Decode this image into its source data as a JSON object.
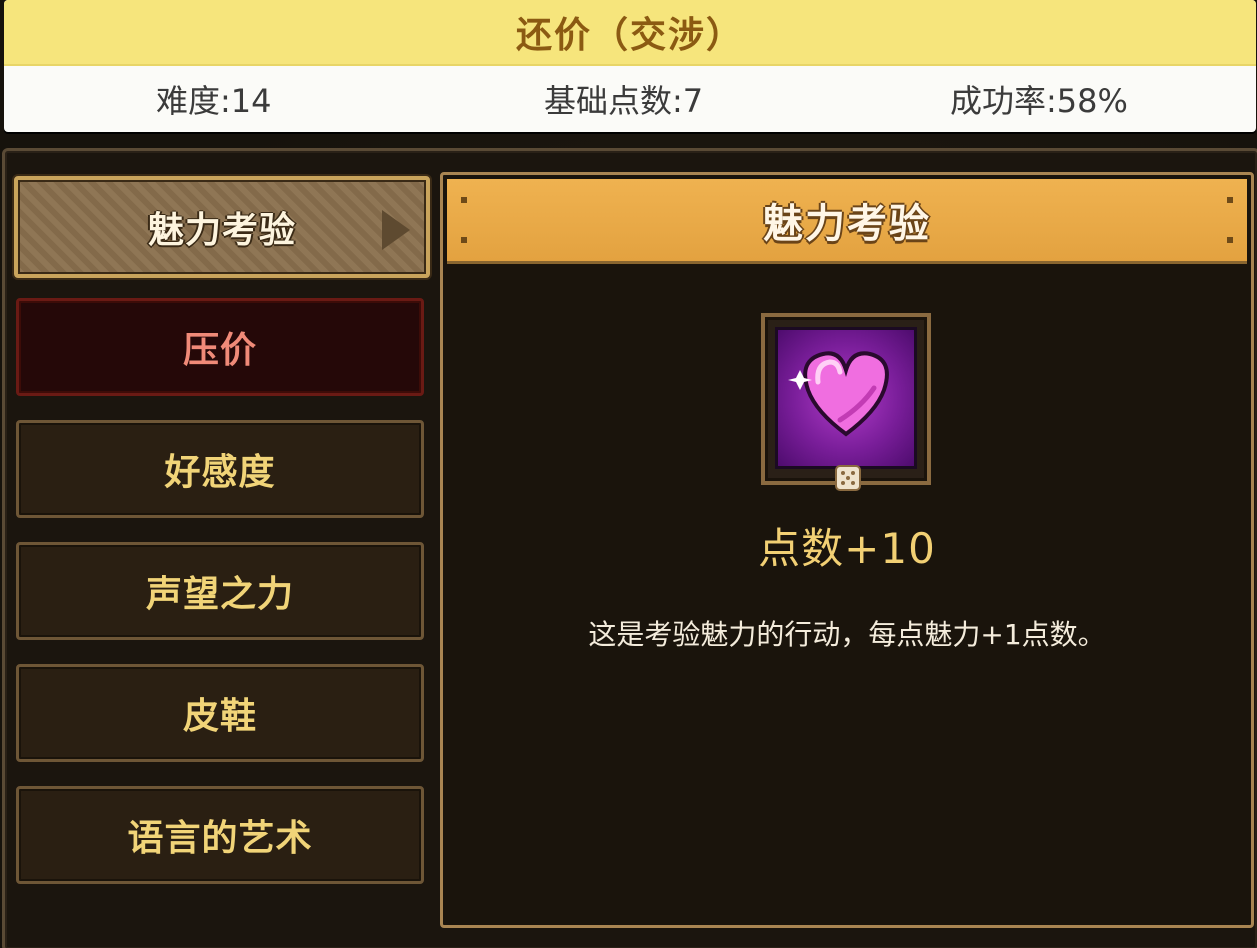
{
  "header": {
    "title": "还价（交涉）",
    "difficulty": "难度:14",
    "base_points": "基础点数:7",
    "success_rate": "成功率:58%"
  },
  "menu": {
    "items": [
      {
        "label": "魅力考验",
        "state": "selected"
      },
      {
        "label": "压价",
        "state": "danger"
      },
      {
        "label": "好感度",
        "state": "normal"
      },
      {
        "label": "声望之力",
        "state": "normal"
      },
      {
        "label": "皮鞋",
        "state": "normal"
      },
      {
        "label": "语言的艺术",
        "state": "normal"
      }
    ]
  },
  "detail": {
    "title": "魅力考验",
    "icon": "pink-heart-icon",
    "points": "点数+10",
    "description": "这是考验魅力的行动，每点魅力+1点数。"
  },
  "colors": {
    "header_bar": "#f6e57c",
    "title_text": "#8b5a12",
    "menu_text": "#f1d478",
    "danger_text": "#f08a78",
    "detail_header": "#e3a240",
    "points_text": "#f2d074"
  }
}
